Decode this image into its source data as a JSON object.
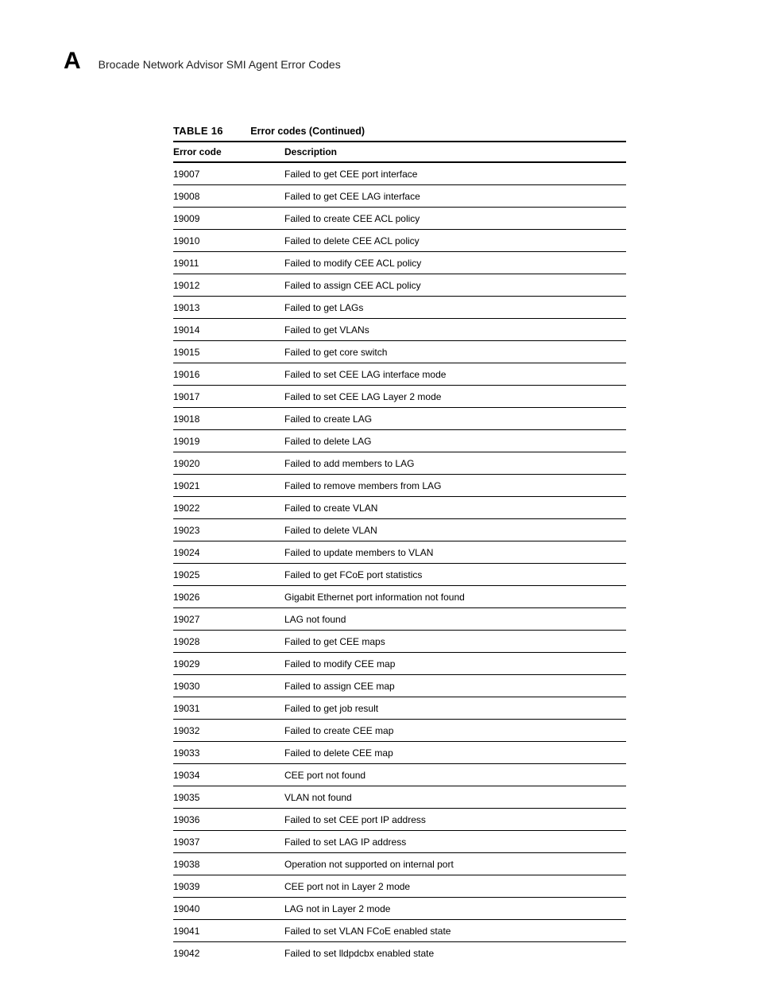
{
  "header": {
    "appendix_letter": "A",
    "title": "Brocade Network Advisor SMI Agent Error Codes"
  },
  "table": {
    "caption_label": "TABLE 16",
    "caption_title": "Error codes (Continued)",
    "columns": {
      "code": "Error code",
      "desc": "Description"
    },
    "rows": [
      {
        "code": "19007",
        "desc": "Failed to get CEE port interface"
      },
      {
        "code": "19008",
        "desc": "Failed to get CEE LAG interface"
      },
      {
        "code": "19009",
        "desc": "Failed to create CEE ACL policy"
      },
      {
        "code": "19010",
        "desc": "Failed to delete CEE ACL policy"
      },
      {
        "code": "19011",
        "desc": "Failed to modify CEE ACL policy"
      },
      {
        "code": "19012",
        "desc": "Failed to assign CEE ACL policy"
      },
      {
        "code": "19013",
        "desc": "Failed to get LAGs"
      },
      {
        "code": "19014",
        "desc": "Failed to get VLANs"
      },
      {
        "code": "19015",
        "desc": "Failed to get core switch"
      },
      {
        "code": "19016",
        "desc": "Failed to set CEE LAG interface mode"
      },
      {
        "code": "19017",
        "desc": "Failed to set CEE LAG Layer 2 mode"
      },
      {
        "code": "19018",
        "desc": "Failed to create LAG"
      },
      {
        "code": "19019",
        "desc": "Failed to delete LAG"
      },
      {
        "code": "19020",
        "desc": "Failed to add members to LAG"
      },
      {
        "code": "19021",
        "desc": "Failed to remove members from LAG"
      },
      {
        "code": "19022",
        "desc": "Failed to create VLAN"
      },
      {
        "code": "19023",
        "desc": "Failed to delete VLAN"
      },
      {
        "code": "19024",
        "desc": "Failed to update members to VLAN"
      },
      {
        "code": "19025",
        "desc": "Failed to get FCoE port statistics"
      },
      {
        "code": "19026",
        "desc": "Gigabit Ethernet port information not found"
      },
      {
        "code": "19027",
        "desc": "LAG not found"
      },
      {
        "code": "19028",
        "desc": "Failed to get CEE maps"
      },
      {
        "code": "19029",
        "desc": "Failed to modify CEE map"
      },
      {
        "code": "19030",
        "desc": "Failed to assign CEE map"
      },
      {
        "code": "19031",
        "desc": "Failed to get job result"
      },
      {
        "code": "19032",
        "desc": "Failed to create CEE map"
      },
      {
        "code": "19033",
        "desc": "Failed to delete CEE map"
      },
      {
        "code": "19034",
        "desc": "CEE port not found"
      },
      {
        "code": "19035",
        "desc": "VLAN not found"
      },
      {
        "code": "19036",
        "desc": "Failed to set CEE port IP address"
      },
      {
        "code": "19037",
        "desc": "Failed to set LAG IP address"
      },
      {
        "code": "19038",
        "desc": "Operation not supported on internal port"
      },
      {
        "code": "19039",
        "desc": "CEE port not in Layer 2 mode"
      },
      {
        "code": "19040",
        "desc": "LAG not in Layer 2 mode"
      },
      {
        "code": "19041",
        "desc": "Failed to set VLAN FCoE enabled state"
      },
      {
        "code": "19042",
        "desc": "Failed to set lldpdcbx enabled state"
      }
    ]
  }
}
